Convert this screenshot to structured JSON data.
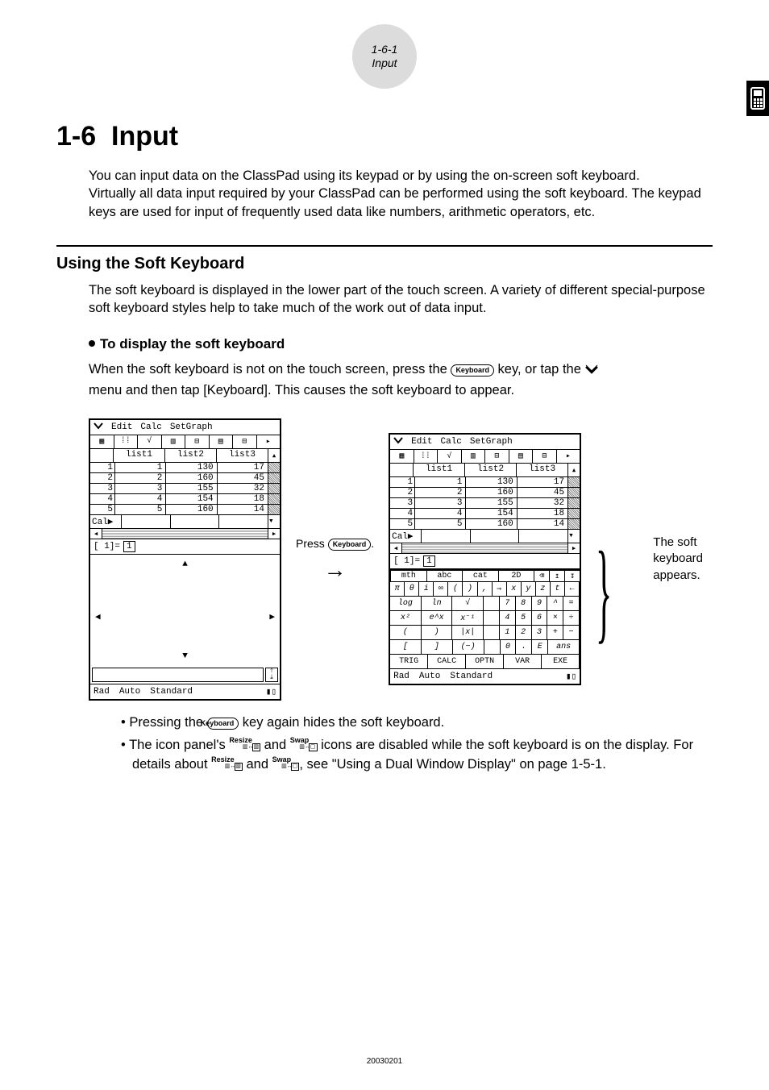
{
  "header": {
    "page_num": "1-6-1",
    "page_name": "Input"
  },
  "chapter": {
    "number": "1-6",
    "title": "Input"
  },
  "intro": {
    "p1": "You can input data on the ClassPad using its keypad or by using the on-screen soft keyboard.",
    "p2": "Virtually all data input required by your ClassPad can be performed using the soft keyboard. The keypad keys are used for input of frequently used data like numbers, arithmetic operators, etc."
  },
  "section": {
    "title": "Using the Soft Keyboard",
    "lead": "The soft keyboard is displayed in the lower part of the touch screen. A variety of different special-purpose soft keyboard styles help to take much of the work out of data input."
  },
  "procedure": {
    "heading": "To display the soft keyboard",
    "line_a": "When the soft keyboard is not on the touch screen, press the ",
    "key1": "Keyboard",
    "line_b": " key, or tap the ",
    "line_c": "menu and then tap [Keyboard]. This causes the soft keyboard to appear."
  },
  "mid": {
    "press_a": "Press ",
    "key": "Keyboard",
    "press_b": "."
  },
  "annot": {
    "line": "The soft keyboard appears."
  },
  "screen": {
    "menu": [
      "Edit",
      "Calc",
      "SetGraph"
    ],
    "list_heads": [
      "list1",
      "list2",
      "list3"
    ],
    "rows": [
      {
        "n": "1",
        "c": [
          "1",
          "130",
          "17"
        ]
      },
      {
        "n": "2",
        "c": [
          "2",
          "160",
          "45"
        ]
      },
      {
        "n": "3",
        "c": [
          "3",
          "155",
          "32"
        ]
      },
      {
        "n": "4",
        "c": [
          "4",
          "154",
          "18"
        ]
      },
      {
        "n": "5",
        "c": [
          "5",
          "160",
          "14"
        ]
      }
    ],
    "cal_label": "Cal▶",
    "entry_label": "[    1]=",
    "entry_value": "1",
    "status": [
      "Rad",
      "Auto",
      "Standard"
    ]
  },
  "kb": {
    "tabs": [
      "mth",
      "abc",
      "cat",
      "2D"
    ],
    "row1": [
      "π",
      "θ",
      "i",
      "∞",
      "(",
      ")",
      ",",
      "⇒",
      "x",
      "y",
      "z",
      "t",
      "←"
    ],
    "row2": [
      "log",
      "ln",
      "√",
      "",
      "7",
      "8",
      "9",
      "^",
      "="
    ],
    "row3": [
      "x²",
      "e^x",
      "x⁻¹",
      "",
      "4",
      "5",
      "6",
      "×",
      "÷"
    ],
    "row4": [
      "(",
      ")",
      "|x|",
      "",
      "1",
      "2",
      "3",
      "+",
      "−"
    ],
    "row5": [
      "[",
      "]",
      "(−)",
      "",
      "0",
      ".",
      "E",
      "ans"
    ],
    "row6": [
      "TRIG",
      "CALC",
      "OPTN",
      "VAR",
      "EXE"
    ]
  },
  "notes": {
    "n1a": "Pressing the ",
    "n1key": "Keyboard",
    "n1b": " key again hides the soft keyboard.",
    "n2a": "The icon panel's ",
    "resize": "Resize",
    "swap": "Swap",
    "n2b": " and ",
    "n2c": " icons are disabled while the soft keyboard is on the display. For details about ",
    "n2d": " and ",
    "n2e": ", see \"Using a Dual Window Display\" on page 1-5-1."
  },
  "footer": "20030201"
}
